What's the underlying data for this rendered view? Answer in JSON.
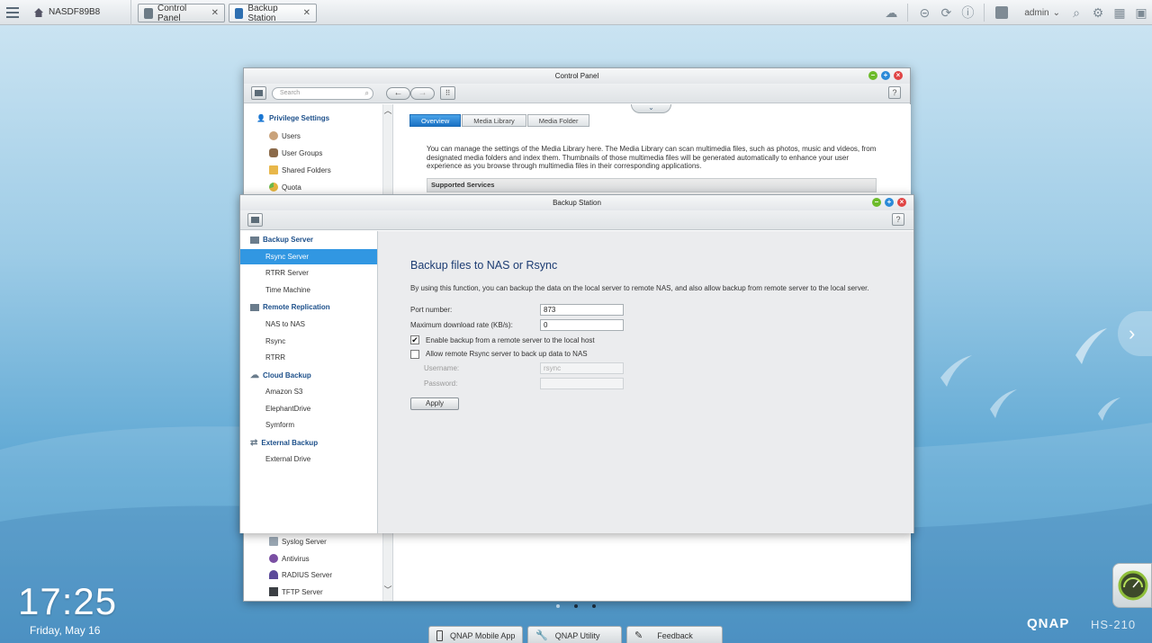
{
  "taskbar": {
    "nas_name": "NASDF89B8",
    "tabs": [
      {
        "label": "Control Panel",
        "close": "✕"
      },
      {
        "label": "Backup Station",
        "close": "✕"
      }
    ],
    "user": "admin"
  },
  "control_panel": {
    "title": "Control Panel",
    "search_placeholder": "Search",
    "help": "?",
    "left": {
      "privilege_heading": "Privilege Settings",
      "items_top": [
        "Users",
        "User Groups",
        "Shared Folders",
        "Quota"
      ],
      "items_bottom": [
        "Syslog Server",
        "Antivirus",
        "RADIUS Server",
        "TFTP Server"
      ]
    },
    "tabs": [
      "Overview",
      "Media Library",
      "Media Folder"
    ],
    "description": "You can manage the settings of the Media Library here. The Media Library can scan multimedia files, such as photos, music and videos, from designated media folders and index them. Thumbnails of those multimedia files will be generated automatically to enhance your user experience as you browse through multimedia files in their corresponding applications.",
    "supported_services": "Supported Services"
  },
  "backup_station": {
    "title": "Backup Station",
    "help": "?",
    "sidebar": {
      "groups": [
        {
          "heading": "Backup Server",
          "items": [
            "Rsync Server",
            "RTRR Server",
            "Time Machine"
          ]
        },
        {
          "heading": "Remote Replication",
          "items": [
            "NAS to NAS",
            "Rsync",
            "RTRR"
          ]
        },
        {
          "heading": "Cloud Backup",
          "items": [
            "Amazon S3",
            "ElephantDrive",
            "Symform"
          ]
        },
        {
          "heading": "External Backup",
          "items": [
            "External Drive"
          ]
        }
      ],
      "selected": "Rsync Server"
    },
    "main": {
      "title": "Backup files to NAS or Rsync",
      "description": "By using this function, you can backup the data on the local server to remote NAS, and also allow backup from remote server to the local server.",
      "port_label": "Port number:",
      "port_value": "873",
      "rate_label": "Maximum download rate (KB/s):",
      "rate_value": "0",
      "enable_remote_label": "Enable backup from a remote server to the local host",
      "enable_remote_checked": true,
      "allow_rsync_label": "Allow remote Rsync server to back up data to NAS",
      "allow_rsync_checked": false,
      "username_label": "Username:",
      "username_value": "rsync",
      "password_label": "Password:",
      "password_value": "",
      "apply_label": "Apply",
      "check_mark": "✔"
    }
  },
  "desktop": {
    "time": "17:25",
    "date": "Friday, May 16",
    "brand": "QNAP",
    "model": "HS-210",
    "dock": [
      "QNAP Mobile App",
      "QNAP Utility",
      "Feedback"
    ]
  },
  "colors": {
    "accent": "#3197e2",
    "heading": "#1c4f8a"
  }
}
